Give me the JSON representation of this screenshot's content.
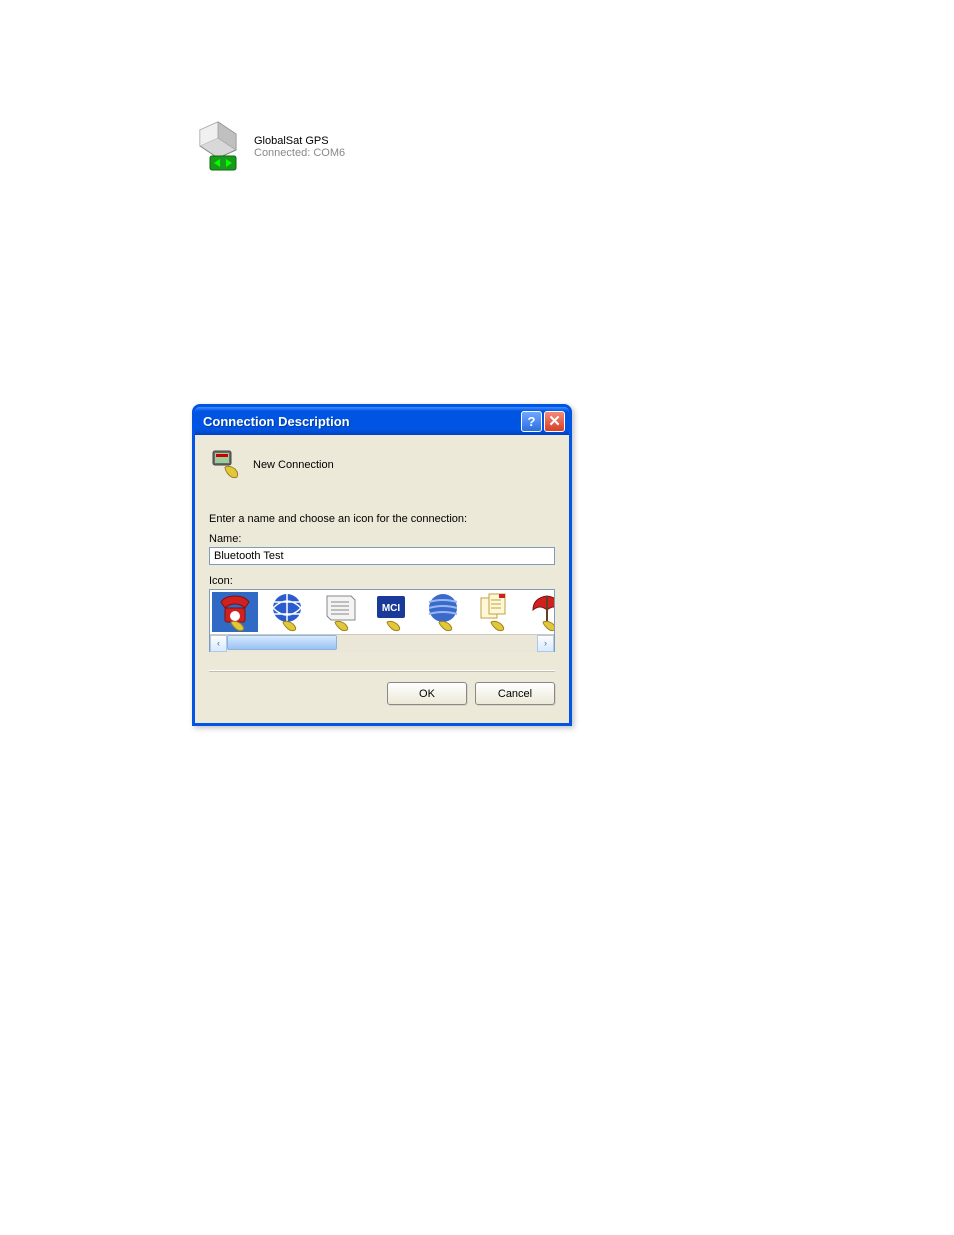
{
  "device": {
    "title": "GlobalSat GPS",
    "status": "Connected: COM6"
  },
  "dialog": {
    "title": "Connection Description",
    "help_glyph": "?",
    "close_glyph": "✕",
    "header_label": "New Connection",
    "instruction": "Enter a name and choose an icon for the connection:",
    "name_label": "Name:",
    "name_value": "Bluetooth Test",
    "icon_label": "Icon:",
    "scroll_left": "‹",
    "scroll_right": "›",
    "ok_label": "OK",
    "cancel_label": "Cancel",
    "icons": [
      {
        "name": "red-phone-modem-icon"
      },
      {
        "name": "globe-modem-icon"
      },
      {
        "name": "newspaper-modem-icon"
      },
      {
        "name": "mci-modem-icon"
      },
      {
        "name": "att-globe-modem-icon"
      },
      {
        "name": "document-pair-modem-icon"
      },
      {
        "name": "umbrella-modem-icon"
      }
    ]
  }
}
